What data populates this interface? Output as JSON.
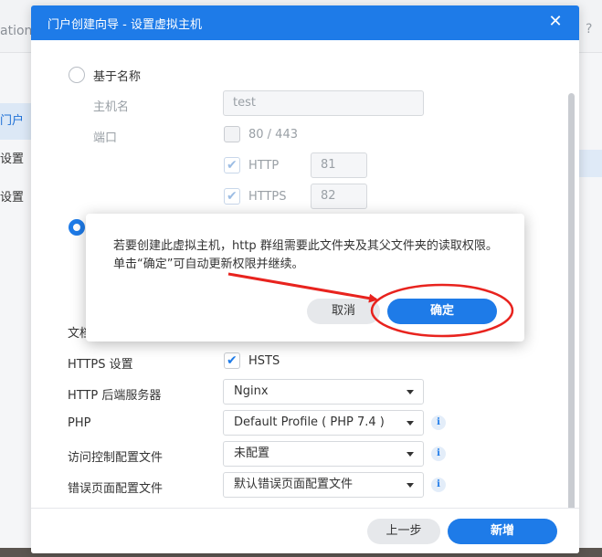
{
  "background": {
    "title_fragment": "ation",
    "help_glyph": "?",
    "sidebar_items": [
      "门户",
      "设置",
      "设置"
    ]
  },
  "dialog": {
    "title": "门户创建向导 - 设置虚拟主机",
    "close_glyph": "✕",
    "name_based_label": "基于名称",
    "hostname_label": "主机名",
    "hostname_value": "test",
    "port_label": "端口",
    "port_default_label": "80 / 443",
    "http_label": "HTTP",
    "http_port": "81",
    "https_label": "HTTPS",
    "https_port": "82",
    "docroot_label_fragment": "文档",
    "https_settings_label": "HTTPS 设置",
    "hsts_label": "HSTS",
    "backend_label": "HTTP 后端服务器",
    "backend_value": "Nginx",
    "php_label": "PHP",
    "php_value": "Default Profile ( PHP 7.4 )",
    "access_control_label": "访问控制配置文件",
    "access_control_value": "未配置",
    "error_page_label": "错误页面配置文件",
    "error_page_value": "默认错误页面配置文件",
    "back_button": "上一步",
    "create_button": "新增"
  },
  "popup": {
    "message": "若要创建此虚拟主机，http 群组需要此文件夹及其父文件夹的读取权限。单击“确定”可自动更新权限并继续。",
    "cancel_button": "取消",
    "ok_button": "确定"
  },
  "colors": {
    "accent": "#1e7be8",
    "annotation_red": "#e8231e"
  }
}
